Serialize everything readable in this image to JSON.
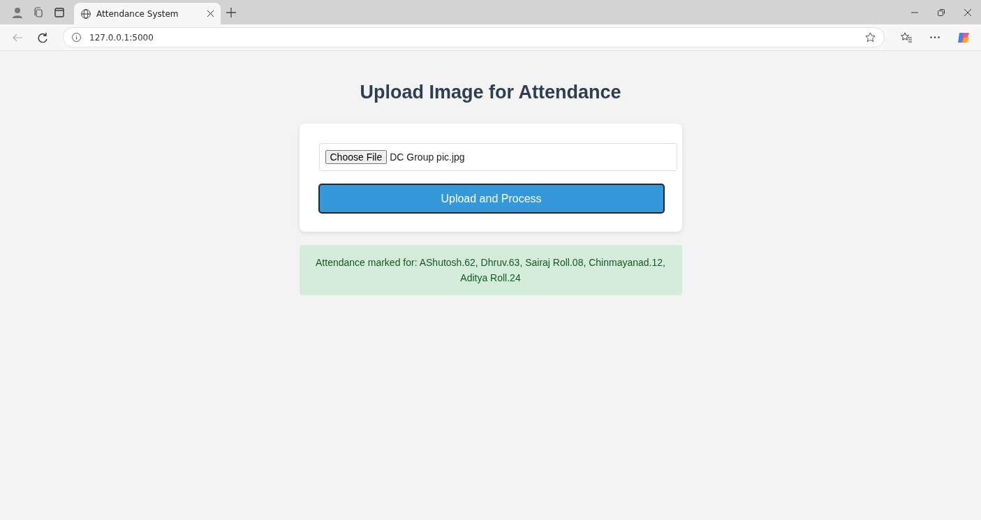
{
  "browser": {
    "tabs": [
      {
        "title": "Attendance System",
        "selected": true
      }
    ],
    "address": "127.0.0.1:5000"
  },
  "page": {
    "heading": "Upload Image for Attendance",
    "file_input": {
      "button": "Choose File",
      "filename": "DC Group pic.jpg"
    },
    "submit": "Upload and Process",
    "message": {
      "kind": "success",
      "text": "Attendance marked for: AShutosh.62, Dhruv.63, Sairaj Roll.08, Chinmayanad.12, Aditya Roll.24"
    }
  }
}
